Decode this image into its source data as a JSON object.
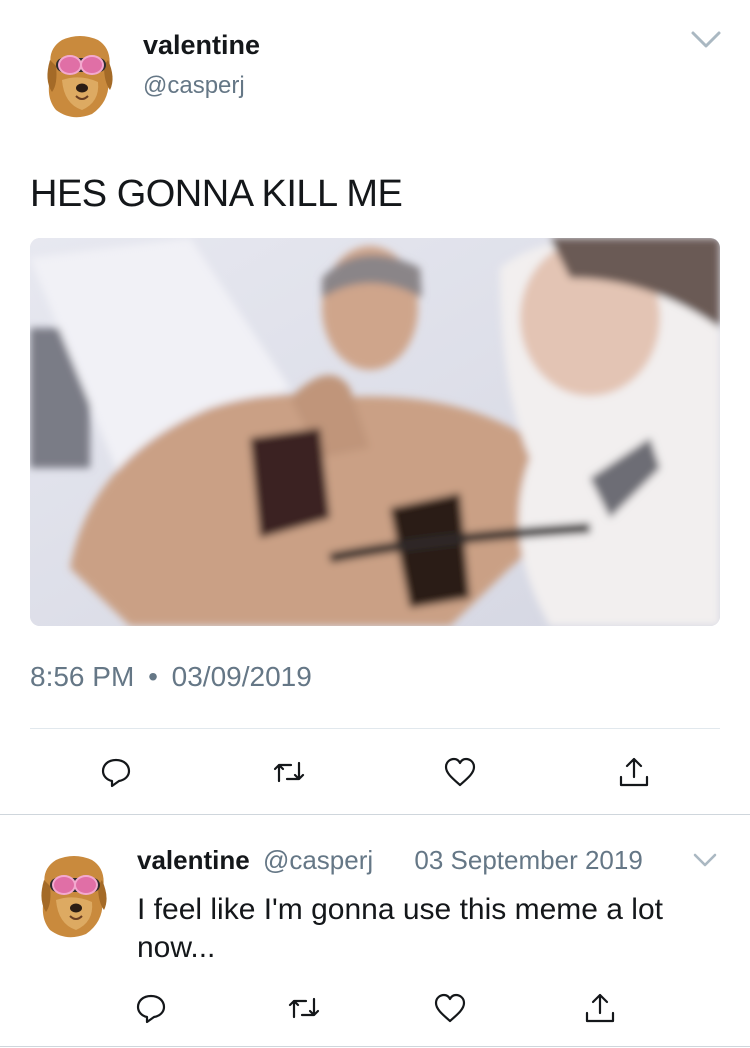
{
  "tweet": {
    "author_name": "valentine",
    "author_handle": "@casperj",
    "text": "HES GONNA KILL ME",
    "time": "8:56 PM",
    "separator": "•",
    "date": "03/09/2019",
    "icons": {
      "menu": "chevron-down-icon",
      "reply": "reply-icon",
      "retweet": "retweet-icon",
      "like": "heart-icon",
      "share": "share-icon"
    }
  },
  "reply": {
    "author_name": "valentine",
    "author_handle": "@casperj",
    "date": "03 September 2019",
    "text": "I feel like I'm gonna use this meme a lot now..."
  },
  "colors": {
    "text_primary": "#14171a",
    "text_secondary": "#657786",
    "divider": "#e1e8ed",
    "icon": "#657786"
  }
}
